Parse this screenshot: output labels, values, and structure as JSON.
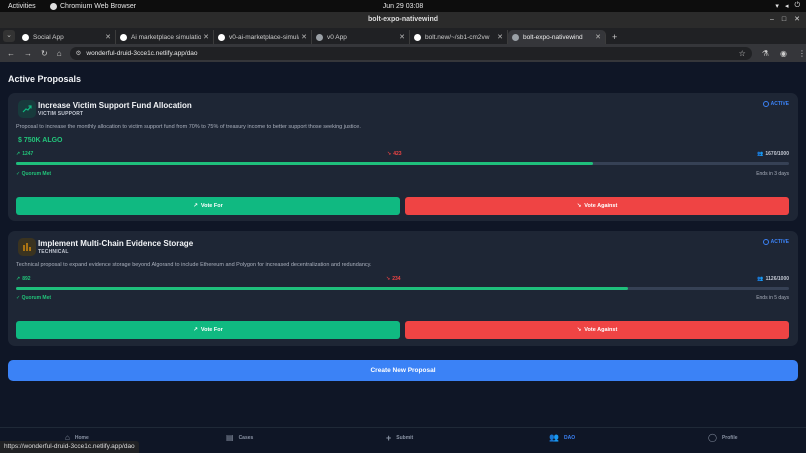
{
  "os_bar": {
    "activities": "Activities",
    "app_name": "Chromium Web Browser",
    "clock": "Jun 29  03:08"
  },
  "window": {
    "title": "bolt-expo-nativewind"
  },
  "tabs": [
    {
      "label": "Social App",
      "favicon_color": "#ffffff"
    },
    {
      "label": "Ai marketplace simulatio",
      "favicon_color": "#ffffff"
    },
    {
      "label": "v0-ai-marketplace-simula",
      "favicon_color": "#ffffff"
    },
    {
      "label": "v0 App",
      "favicon_color": "#9aa0a6"
    },
    {
      "label": "bolt.new/~/sb1-cm2vw",
      "favicon_color": "#ffffff"
    },
    {
      "label": "bolt-expo-nativewind",
      "favicon_color": "#9aa0a6",
      "active": true
    }
  ],
  "address_bar": {
    "url": "wonderful-druid-3cce1c.netlify.app/dao"
  },
  "page": {
    "section_title": "Active Proposals",
    "proposals": [
      {
        "title": "Increase Victim Support Fund Allocation",
        "category": "VICTIM SUPPORT",
        "status": "ACTIVE",
        "description": "Proposal to increase the monthly allocation to victim support fund from 70% to 75% of treasury income to better support those seeking justice.",
        "funding": "750K ALGO",
        "votes_for": "1247",
        "votes_against": "423",
        "total_votes": "1670/1000",
        "for_fraction": 0.747,
        "quorum": "Quorum Met",
        "ends": "Ends in 3 days",
        "vote_for_label": "Vote For",
        "vote_against_label": "Vote Against",
        "icon": "trending-up-icon",
        "icon_color": "#10b981"
      },
      {
        "title": "Implement Multi-Chain Evidence Storage",
        "category": "TECHNICAL",
        "status": "ACTIVE",
        "description": "Technical proposal to expand evidence storage beyond Algorand to include Ethereum and Polygon for increased decentralization and redundancy.",
        "votes_for": "892",
        "votes_against": "234",
        "total_votes": "1126/1000",
        "for_fraction": 0.792,
        "quorum": "Quorum Met",
        "ends": "Ends in 5 days",
        "vote_for_label": "Vote For",
        "vote_against_label": "Vote Against",
        "icon": "bar-chart-icon",
        "icon_color": "#f59e0b"
      }
    ],
    "create_button": "Create New Proposal"
  },
  "bottom_nav": [
    {
      "label": "Home",
      "icon": "home-icon"
    },
    {
      "label": "Cases",
      "icon": "document-icon"
    },
    {
      "label": "Submit",
      "icon": "plus-icon"
    },
    {
      "label": "DAO",
      "icon": "users-icon",
      "active": true
    },
    {
      "label": "Profile",
      "icon": "user-icon"
    }
  ],
  "status_bar_url": "https://wonderful-druid-3cce1c.netlify.app/dao",
  "colors": {
    "background": "#0f1626",
    "card": "#1e2635",
    "accent": "#3b82f6",
    "for": "#10b981",
    "against": "#ef4444"
  }
}
